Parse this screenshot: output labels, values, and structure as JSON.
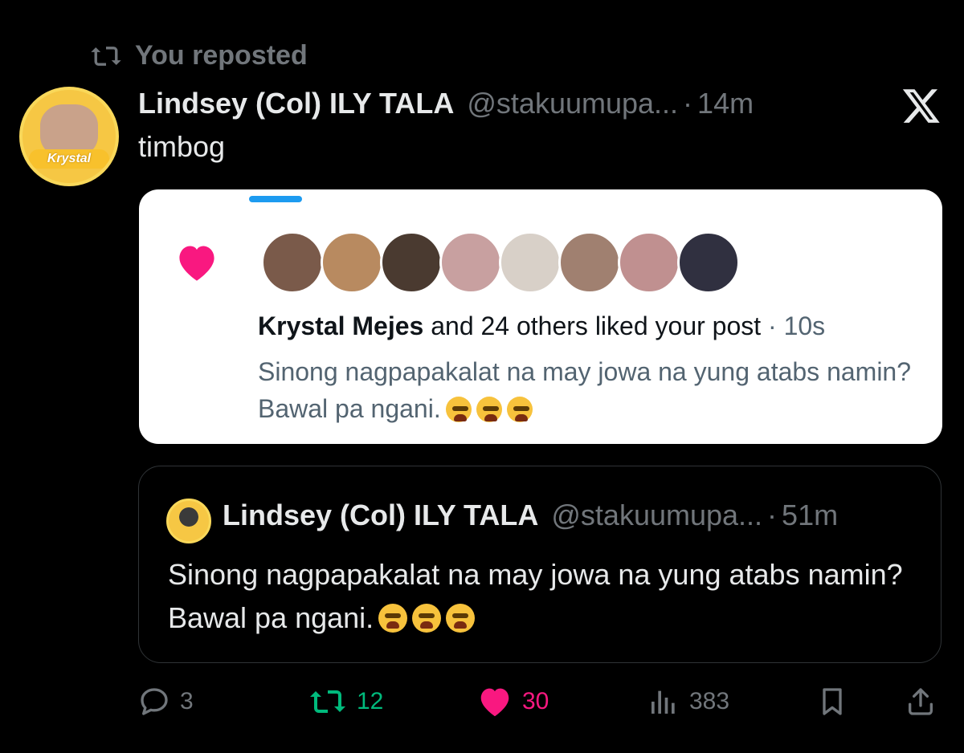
{
  "repost": {
    "label": "You reposted"
  },
  "post": {
    "author_name": "Lindsey (Col) ILY TALA",
    "handle": "@stakuumupa...",
    "time": "14m",
    "text": "timbog",
    "avatar_badge": "Krystal"
  },
  "notification": {
    "liker": "Krystal Mejes",
    "summary": "and 24 others liked your post",
    "time": "10s",
    "quote_text": "Sinong nagpapakalat na may jowa na yung atabs namin? Bawal pa ngani.",
    "avatar_colors": [
      "#7a5a4a",
      "#b88a60",
      "#4a3a30",
      "#c8a0a0",
      "#d8d0c8",
      "#a08070",
      "#c09090",
      "#303040"
    ]
  },
  "quoted": {
    "author_name": "Lindsey (Col) ILY TALA",
    "handle": "@stakuumupa...",
    "time": "51m",
    "text": "Sinong nagpapakalat na may jowa na yung atabs namin? Bawal pa ngani."
  },
  "actions": {
    "replies": "3",
    "reposts": "12",
    "likes": "30",
    "views": "383"
  },
  "colors": {
    "repost_active": "#00ba7c",
    "like_active": "#f91880",
    "muted": "#71767b"
  }
}
